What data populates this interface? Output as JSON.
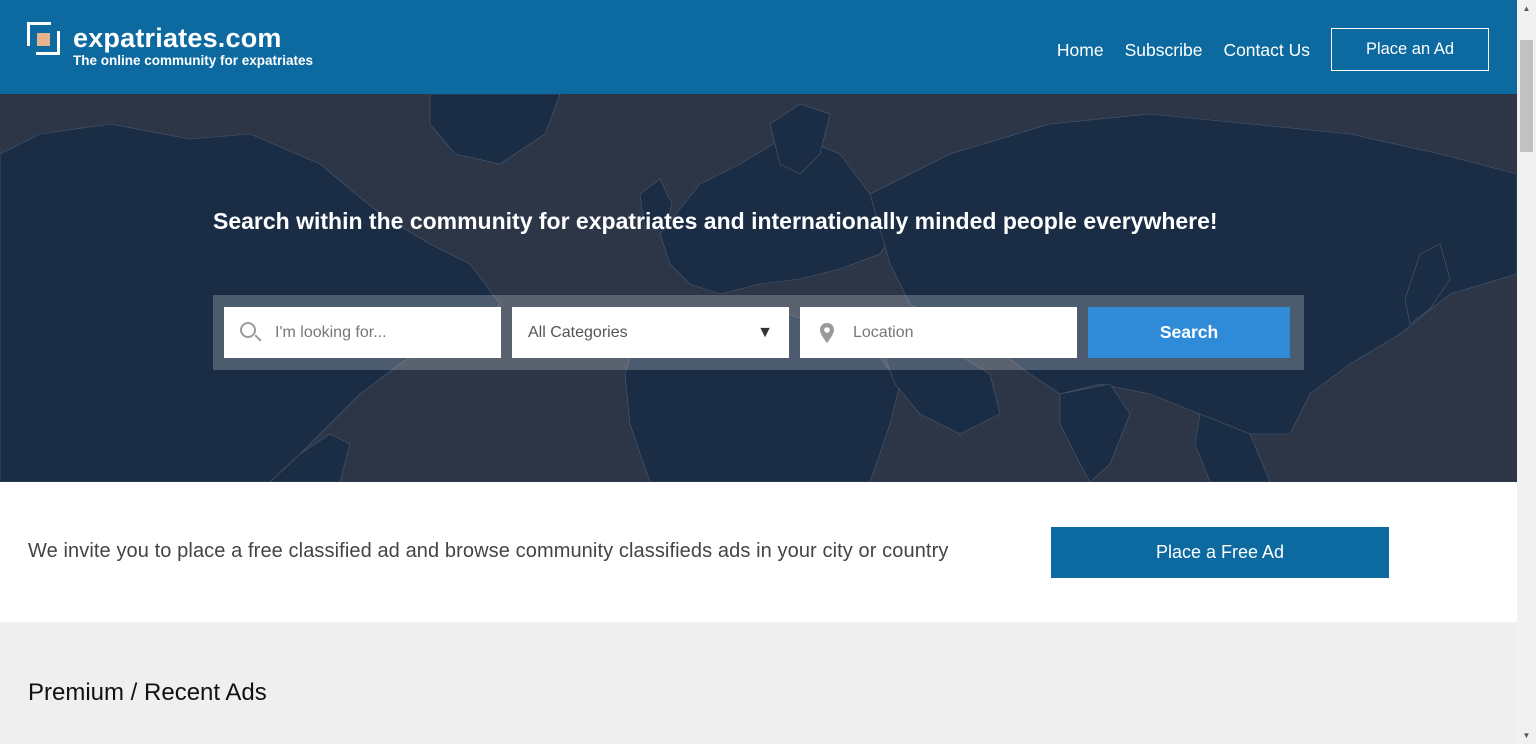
{
  "header": {
    "site_name": "expatriates.com",
    "tagline": "The online community for expatriates",
    "nav": [
      {
        "label": "Home"
      },
      {
        "label": "Subscribe"
      },
      {
        "label": "Contact Us"
      }
    ],
    "place_ad_label": "Place an Ad",
    "brand_color": "#0c6aa0",
    "logo_accent": "#e9b48b"
  },
  "hero": {
    "title": "Search within the community for expatriates and internationally minded people everywhere!",
    "search": {
      "keyword_placeholder": "I'm looking for...",
      "category_selected": "All Categories",
      "location_placeholder": "Location",
      "button_label": "Search",
      "button_color": "#2f8ad8"
    },
    "icons": [
      "search-icon",
      "dropdown-caret-icon",
      "location-pin-icon"
    ]
  },
  "invite": {
    "text": "We invite you to place a free classified ad and browse community classifieds ads in your city or country",
    "button_label": "Place a Free Ad"
  },
  "recent": {
    "title": "Premium / Recent Ads"
  }
}
